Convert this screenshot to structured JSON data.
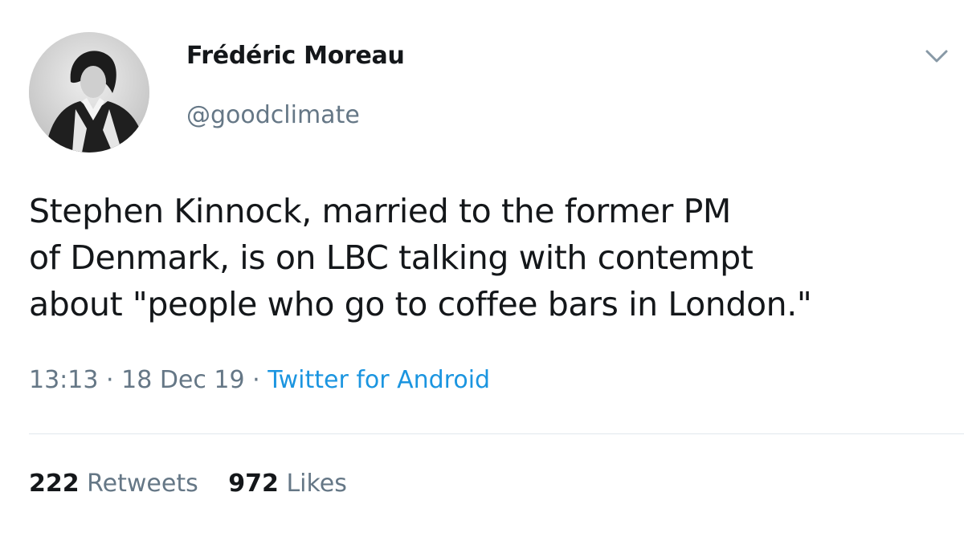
{
  "author": {
    "display_name": "Frédéric Moreau",
    "handle": "@goodclimate"
  },
  "tweet": {
    "text_lines": [
      "Stephen Kinnock, married to the former PM",
      "of Denmark, is on LBC talking with contempt",
      "about \"people who go to coffee bars in London.\""
    ],
    "time": "13:13",
    "separator": "·",
    "date": "18 Dec 19",
    "source": "Twitter for Android"
  },
  "stats": {
    "retweets_count": "222",
    "retweets_label": "Retweets",
    "likes_count": "972",
    "likes_label": "Likes"
  },
  "icons": {
    "menu": "chevron-down-icon",
    "avatar": "avatar"
  },
  "colors": {
    "text_primary": "#14171a",
    "text_secondary": "#657786",
    "link": "#1b95e0",
    "divider": "#e1e8ed"
  }
}
